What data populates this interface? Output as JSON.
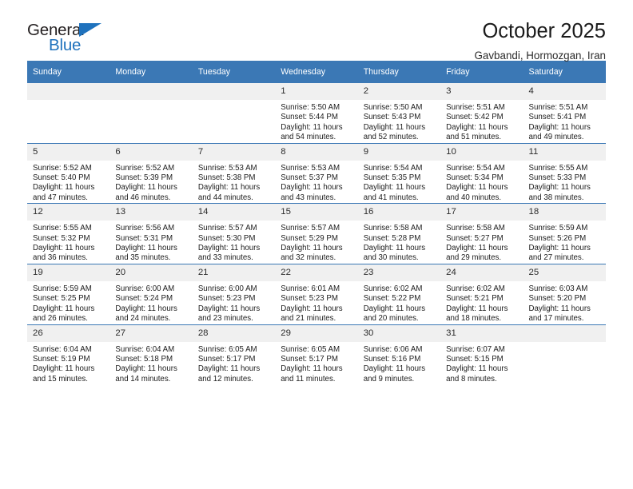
{
  "brand": {
    "name_top": "General",
    "name_bottom": "Blue",
    "triangle_color": "#1f72bd",
    "text_color": "#231f20"
  },
  "header": {
    "title": "October 2025",
    "subtitle": "Gavbandi, Hormozgan, Iran",
    "header_bg": "#3b78b5",
    "header_text_color": "#ffffff"
  },
  "weekdays": [
    "Sunday",
    "Monday",
    "Tuesday",
    "Wednesday",
    "Thursday",
    "Friday",
    "Saturday"
  ],
  "labels": {
    "sunrise": "Sunrise:",
    "sunset": "Sunset:",
    "daylight": "Daylight:"
  },
  "weeks": [
    [
      {
        "day": "",
        "sunrise": "",
        "sunset": "",
        "daylight_line1": "",
        "daylight_line2": ""
      },
      {
        "day": "",
        "sunrise": "",
        "sunset": "",
        "daylight_line1": "",
        "daylight_line2": ""
      },
      {
        "day": "",
        "sunrise": "",
        "sunset": "",
        "daylight_line1": "",
        "daylight_line2": ""
      },
      {
        "day": "1",
        "sunrise": "Sunrise: 5:50 AM",
        "sunset": "Sunset: 5:44 PM",
        "daylight_line1": "Daylight: 11 hours",
        "daylight_line2": "and 54 minutes."
      },
      {
        "day": "2",
        "sunrise": "Sunrise: 5:50 AM",
        "sunset": "Sunset: 5:43 PM",
        "daylight_line1": "Daylight: 11 hours",
        "daylight_line2": "and 52 minutes."
      },
      {
        "day": "3",
        "sunrise": "Sunrise: 5:51 AM",
        "sunset": "Sunset: 5:42 PM",
        "daylight_line1": "Daylight: 11 hours",
        "daylight_line2": "and 51 minutes."
      },
      {
        "day": "4",
        "sunrise": "Sunrise: 5:51 AM",
        "sunset": "Sunset: 5:41 PM",
        "daylight_line1": "Daylight: 11 hours",
        "daylight_line2": "and 49 minutes."
      }
    ],
    [
      {
        "day": "5",
        "sunrise": "Sunrise: 5:52 AM",
        "sunset": "Sunset: 5:40 PM",
        "daylight_line1": "Daylight: 11 hours",
        "daylight_line2": "and 47 minutes."
      },
      {
        "day": "6",
        "sunrise": "Sunrise: 5:52 AM",
        "sunset": "Sunset: 5:39 PM",
        "daylight_line1": "Daylight: 11 hours",
        "daylight_line2": "and 46 minutes."
      },
      {
        "day": "7",
        "sunrise": "Sunrise: 5:53 AM",
        "sunset": "Sunset: 5:38 PM",
        "daylight_line1": "Daylight: 11 hours",
        "daylight_line2": "and 44 minutes."
      },
      {
        "day": "8",
        "sunrise": "Sunrise: 5:53 AM",
        "sunset": "Sunset: 5:37 PM",
        "daylight_line1": "Daylight: 11 hours",
        "daylight_line2": "and 43 minutes."
      },
      {
        "day": "9",
        "sunrise": "Sunrise: 5:54 AM",
        "sunset": "Sunset: 5:35 PM",
        "daylight_line1": "Daylight: 11 hours",
        "daylight_line2": "and 41 minutes."
      },
      {
        "day": "10",
        "sunrise": "Sunrise: 5:54 AM",
        "sunset": "Sunset: 5:34 PM",
        "daylight_line1": "Daylight: 11 hours",
        "daylight_line2": "and 40 minutes."
      },
      {
        "day": "11",
        "sunrise": "Sunrise: 5:55 AM",
        "sunset": "Sunset: 5:33 PM",
        "daylight_line1": "Daylight: 11 hours",
        "daylight_line2": "and 38 minutes."
      }
    ],
    [
      {
        "day": "12",
        "sunrise": "Sunrise: 5:55 AM",
        "sunset": "Sunset: 5:32 PM",
        "daylight_line1": "Daylight: 11 hours",
        "daylight_line2": "and 36 minutes."
      },
      {
        "day": "13",
        "sunrise": "Sunrise: 5:56 AM",
        "sunset": "Sunset: 5:31 PM",
        "daylight_line1": "Daylight: 11 hours",
        "daylight_line2": "and 35 minutes."
      },
      {
        "day": "14",
        "sunrise": "Sunrise: 5:57 AM",
        "sunset": "Sunset: 5:30 PM",
        "daylight_line1": "Daylight: 11 hours",
        "daylight_line2": "and 33 minutes."
      },
      {
        "day": "15",
        "sunrise": "Sunrise: 5:57 AM",
        "sunset": "Sunset: 5:29 PM",
        "daylight_line1": "Daylight: 11 hours",
        "daylight_line2": "and 32 minutes."
      },
      {
        "day": "16",
        "sunrise": "Sunrise: 5:58 AM",
        "sunset": "Sunset: 5:28 PM",
        "daylight_line1": "Daylight: 11 hours",
        "daylight_line2": "and 30 minutes."
      },
      {
        "day": "17",
        "sunrise": "Sunrise: 5:58 AM",
        "sunset": "Sunset: 5:27 PM",
        "daylight_line1": "Daylight: 11 hours",
        "daylight_line2": "and 29 minutes."
      },
      {
        "day": "18",
        "sunrise": "Sunrise: 5:59 AM",
        "sunset": "Sunset: 5:26 PM",
        "daylight_line1": "Daylight: 11 hours",
        "daylight_line2": "and 27 minutes."
      }
    ],
    [
      {
        "day": "19",
        "sunrise": "Sunrise: 5:59 AM",
        "sunset": "Sunset: 5:25 PM",
        "daylight_line1": "Daylight: 11 hours",
        "daylight_line2": "and 26 minutes."
      },
      {
        "day": "20",
        "sunrise": "Sunrise: 6:00 AM",
        "sunset": "Sunset: 5:24 PM",
        "daylight_line1": "Daylight: 11 hours",
        "daylight_line2": "and 24 minutes."
      },
      {
        "day": "21",
        "sunrise": "Sunrise: 6:00 AM",
        "sunset": "Sunset: 5:23 PM",
        "daylight_line1": "Daylight: 11 hours",
        "daylight_line2": "and 23 minutes."
      },
      {
        "day": "22",
        "sunrise": "Sunrise: 6:01 AM",
        "sunset": "Sunset: 5:23 PM",
        "daylight_line1": "Daylight: 11 hours",
        "daylight_line2": "and 21 minutes."
      },
      {
        "day": "23",
        "sunrise": "Sunrise: 6:02 AM",
        "sunset": "Sunset: 5:22 PM",
        "daylight_line1": "Daylight: 11 hours",
        "daylight_line2": "and 20 minutes."
      },
      {
        "day": "24",
        "sunrise": "Sunrise: 6:02 AM",
        "sunset": "Sunset: 5:21 PM",
        "daylight_line1": "Daylight: 11 hours",
        "daylight_line2": "and 18 minutes."
      },
      {
        "day": "25",
        "sunrise": "Sunrise: 6:03 AM",
        "sunset": "Sunset: 5:20 PM",
        "daylight_line1": "Daylight: 11 hours",
        "daylight_line2": "and 17 minutes."
      }
    ],
    [
      {
        "day": "26",
        "sunrise": "Sunrise: 6:04 AM",
        "sunset": "Sunset: 5:19 PM",
        "daylight_line1": "Daylight: 11 hours",
        "daylight_line2": "and 15 minutes."
      },
      {
        "day": "27",
        "sunrise": "Sunrise: 6:04 AM",
        "sunset": "Sunset: 5:18 PM",
        "daylight_line1": "Daylight: 11 hours",
        "daylight_line2": "and 14 minutes."
      },
      {
        "day": "28",
        "sunrise": "Sunrise: 6:05 AM",
        "sunset": "Sunset: 5:17 PM",
        "daylight_line1": "Daylight: 11 hours",
        "daylight_line2": "and 12 minutes."
      },
      {
        "day": "29",
        "sunrise": "Sunrise: 6:05 AM",
        "sunset": "Sunset: 5:17 PM",
        "daylight_line1": "Daylight: 11 hours",
        "daylight_line2": "and 11 minutes."
      },
      {
        "day": "30",
        "sunrise": "Sunrise: 6:06 AM",
        "sunset": "Sunset: 5:16 PM",
        "daylight_line1": "Daylight: 11 hours",
        "daylight_line2": "and 9 minutes."
      },
      {
        "day": "31",
        "sunrise": "Sunrise: 6:07 AM",
        "sunset": "Sunset: 5:15 PM",
        "daylight_line1": "Daylight: 11 hours",
        "daylight_line2": "and 8 minutes."
      },
      {
        "day": "",
        "sunrise": "",
        "sunset": "",
        "daylight_line1": "",
        "daylight_line2": ""
      }
    ]
  ]
}
